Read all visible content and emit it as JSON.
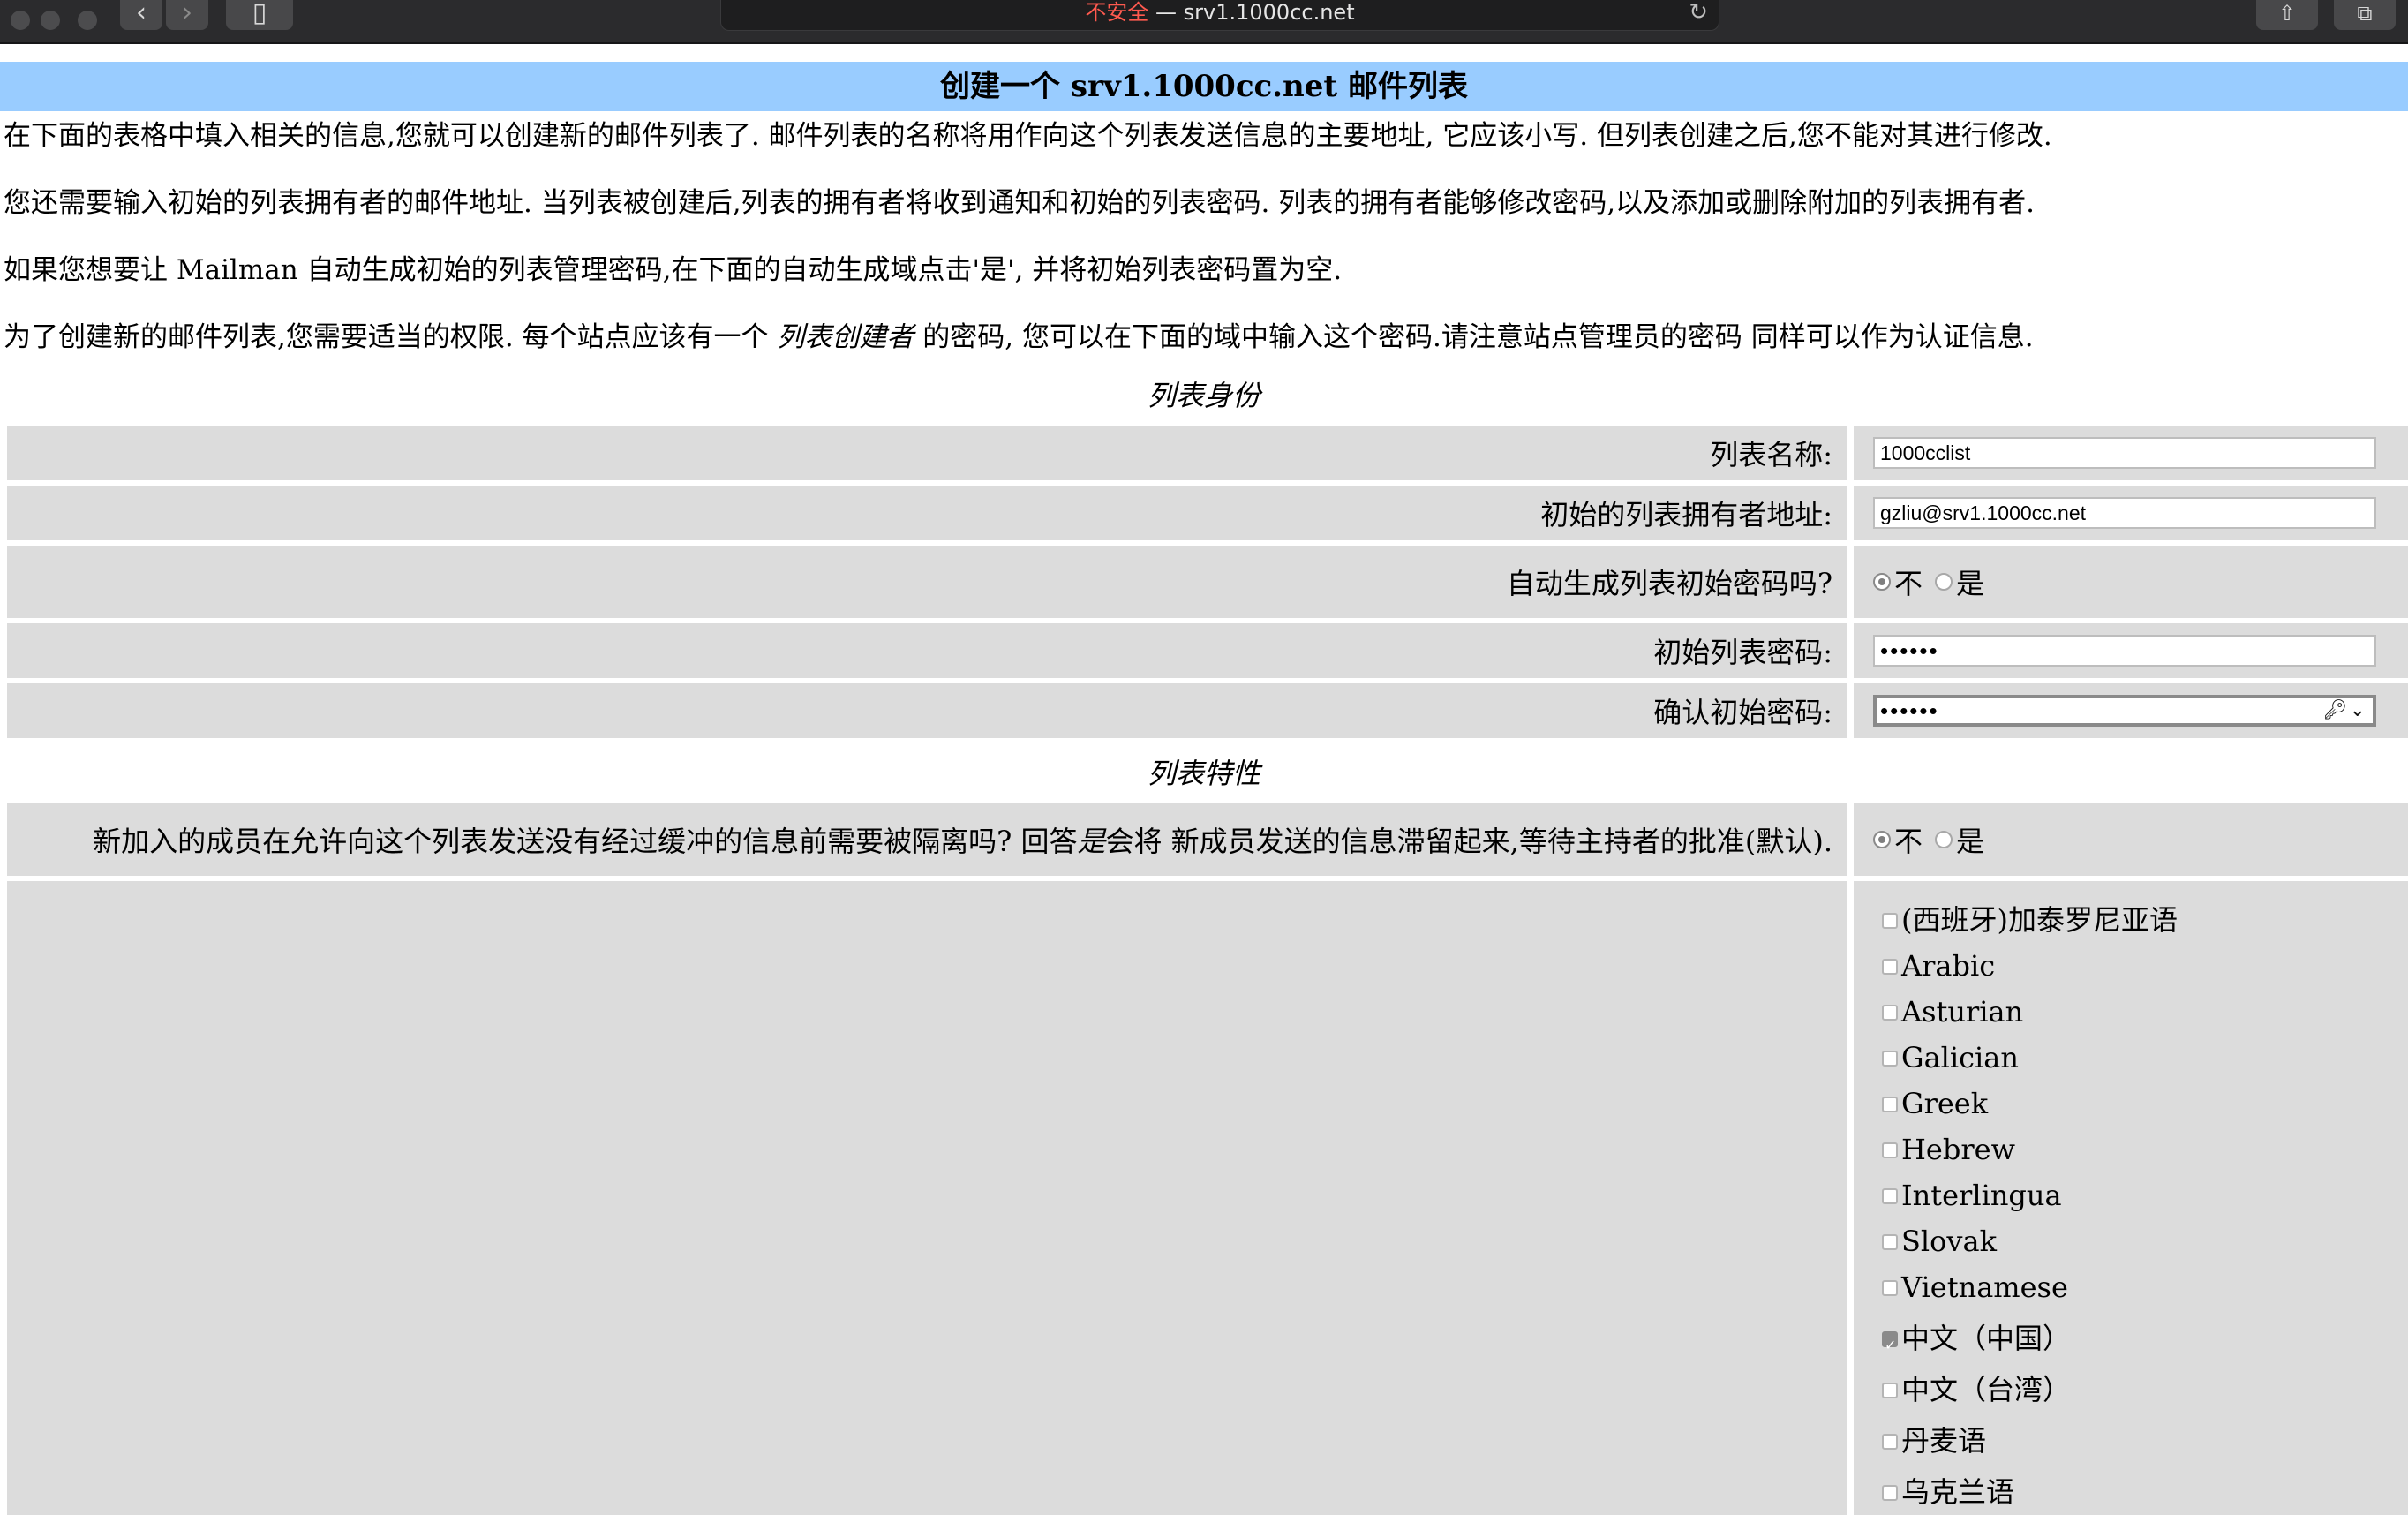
{
  "browser": {
    "insecure_label": "不安全",
    "separator": " — ",
    "host": "srv1.1000cc.net",
    "back_icon": "‹",
    "forward_icon": "›",
    "sidebar_icon": "▯",
    "reload_icon": "↻",
    "share_icon": "⇧",
    "tabs_icon": "⧉"
  },
  "page": {
    "title": "创建一个 srv1.1000cc.net 邮件列表",
    "intro": [
      "在下面的表格中填入相关的信息,您就可以创建新的邮件列表了. 邮件列表的名称将用作向这个列表发送信息的主要地址, 它应该小写. 但列表创建之后,您不能对其进行修改.",
      "您还需要输入初始的列表拥有者的邮件地址. 当列表被创建后,列表的拥有者将收到通知和初始的列表密码. 列表的拥有者能够修改密码,以及添加或删除附加的列表拥有者.",
      "如果您想要让 Mailman 自动生成初始的列表管理密码,在下面的自动生成域点击'是', 并将初始列表密码置为空."
    ],
    "intro4": {
      "before": "为了创建新的邮件列表,您需要适当的权限. 每个站点应该有一个 ",
      "em": "列表创建者",
      "after": " 的密码, 您可以在下面的域中输入这个密码.请注意站点管理员的密码 同样可以作为认证信息."
    }
  },
  "identity": {
    "section_title": "列表身份",
    "list_name_label": "列表名称:",
    "list_name_value": "1000cclist",
    "owner_label": "初始的列表拥有者地址:",
    "owner_value": "gzliu@srv1.1000cc.net",
    "autogen_label": "自动生成列表初始密码吗?",
    "no_label": "不",
    "yes_label": "是",
    "autogen_selected": "不",
    "password_label": "初始列表密码:",
    "password_value": "••••••",
    "confirm_label": "确认初始密码:",
    "confirm_value": "••••••",
    "key_icon": "🔑︎⌄"
  },
  "features": {
    "section_title": "列表特性",
    "moderate_q_before": "新加入的成员在允许向这个列表发送没有经过缓冲的信息前需要被隔离吗? 回答 ",
    "moderate_q_em": "是",
    "moderate_q_after": " 会将 新成员发送的信息滞留起来,等待主持者的批准(默认).",
    "no_label": "不",
    "yes_label": "是",
    "moderate_selected": "不",
    "languages": [
      {
        "label": "(西班牙)加泰罗尼亚语",
        "checked": false
      },
      {
        "label": "Arabic",
        "checked": false
      },
      {
        "label": "Asturian",
        "checked": false
      },
      {
        "label": "Galician",
        "checked": false
      },
      {
        "label": "Greek",
        "checked": false
      },
      {
        "label": "Hebrew",
        "checked": false
      },
      {
        "label": "Interlingua",
        "checked": false
      },
      {
        "label": "Slovak",
        "checked": false
      },
      {
        "label": "Vietnamese",
        "checked": false
      },
      {
        "label": "中文（中国）",
        "checked": true
      },
      {
        "label": "中文（台湾）",
        "checked": false
      },
      {
        "label": "丹麦语",
        "checked": false
      },
      {
        "label": "乌克兰语",
        "checked": false
      }
    ]
  }
}
